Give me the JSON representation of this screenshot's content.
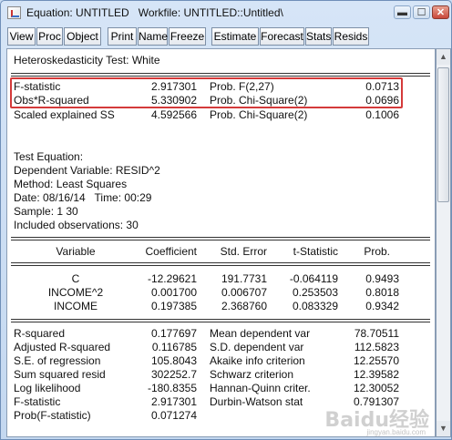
{
  "window": {
    "title": "Equation: UNTITLED   Workfile: UNTITLED::Untitled\\",
    "controls": {
      "minimize": "▬",
      "maximize": "☐",
      "close": "✕"
    }
  },
  "toolbar": [
    "View",
    "Proc",
    "Object",
    "Print",
    "Name",
    "Freeze",
    "Estimate",
    "Forecast",
    "Stats",
    "Resids"
  ],
  "output": {
    "test_title": "Heteroskedasticity Test: White",
    "stats": [
      {
        "label": "F-statistic",
        "value": "2.917301",
        "prob_label": "Prob. F(2,27)",
        "prob": "0.0713"
      },
      {
        "label": "Obs*R-squared",
        "value": "5.330902",
        "prob_label": "Prob. Chi-Square(2)",
        "prob": "0.0696"
      },
      {
        "label": "Scaled explained SS",
        "value": "4.592566",
        "prob_label": "Prob. Chi-Square(2)",
        "prob": "0.1006"
      }
    ],
    "info": [
      "Test Equation:",
      "Dependent Variable: RESID^2",
      "Method: Least Squares",
      "Date: 08/16/14   Time: 00:29",
      "Sample: 1 30",
      "Included observations: 30"
    ],
    "coef_headers": [
      "Variable",
      "Coefficient",
      "Std. Error",
      "t-Statistic",
      "Prob."
    ],
    "coef_rows": [
      [
        "C",
        "-12.29621",
        "191.7731",
        "-0.064119",
        "0.9493"
      ],
      [
        "INCOME^2",
        "0.001700",
        "0.006707",
        "0.253503",
        "0.8018"
      ],
      [
        "INCOME",
        "0.197385",
        "2.368760",
        "0.083329",
        "0.9342"
      ]
    ],
    "summary": [
      [
        "R-squared",
        "0.177697",
        "Mean dependent var",
        "78.70511"
      ],
      [
        "Adjusted R-squared",
        "0.116785",
        "S.D. dependent var",
        "112.5823"
      ],
      [
        "S.E. of regression",
        "105.8043",
        "Akaike info criterion",
        "12.25570"
      ],
      [
        "Sum squared resid",
        "302252.7",
        "Schwarz criterion",
        "12.39582"
      ],
      [
        "Log likelihood",
        "-180.8355",
        "Hannan-Quinn criter.",
        "12.30052"
      ],
      [
        "F-statistic",
        "2.917301",
        "Durbin-Watson stat",
        "0.791307"
      ],
      [
        "Prob(F-statistic)",
        "0.071274",
        "",
        ""
      ]
    ]
  },
  "watermark": {
    "text": "Baidu经验",
    "sub": "jingyan.baidu.com"
  }
}
